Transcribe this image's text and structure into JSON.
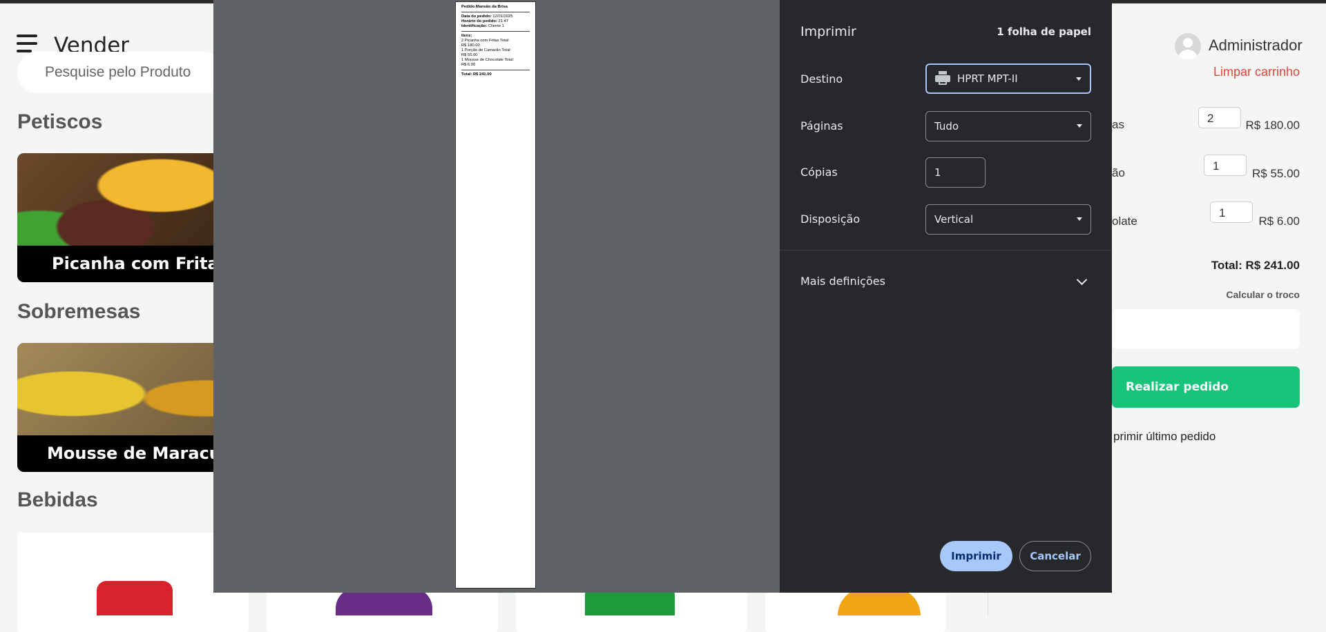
{
  "app": {
    "title": "Vender",
    "search_placeholder": "Pesquise pelo Produto"
  },
  "menu": {
    "sections": [
      {
        "title": "Petiscos",
        "items": [
          "Picanha com Fritas"
        ]
      },
      {
        "title": "Sobremesas",
        "items": [
          "Mousse de Maracujá"
        ]
      },
      {
        "title": "Bebidas",
        "items": []
      }
    ]
  },
  "cart": {
    "user": "Administrador",
    "clear_label": "Limpar carrinho",
    "items": [
      {
        "name_visible": "as",
        "qty": "2",
        "price": "R$ 180.00"
      },
      {
        "name_visible": "ão",
        "qty": "1",
        "price": "R$ 55.00"
      },
      {
        "name_visible": "olate",
        "qty": "1",
        "price": "R$ 6.00"
      }
    ],
    "total": "Total: R$ 241.00",
    "change_label": "Calcular o troco",
    "order_button": "Realizar pedido",
    "reprint_label": "primir último pedido"
  },
  "print_dialog": {
    "title": "Imprimir",
    "sheet_count": "1 folha de papel",
    "destination_label": "Destino",
    "destination_value": "HPRT MPT-II",
    "pages_label": "Páginas",
    "pages_value": "Tudo",
    "copies_label": "Cópias",
    "copies_value": "1",
    "layout_label": "Disposição",
    "layout_value": "Vertical",
    "more_settings": "Mais definições",
    "print_button": "Imprimir",
    "cancel_button": "Cancelar",
    "preview": {
      "heading": "Pedido Mansão da Brisa",
      "date_label": "Data do pedido:",
      "date": "12/01/2025",
      "time_label": "Horário do pedido:",
      "time": "21:47",
      "id_label": "Identificação:",
      "id": "Cliente 1",
      "items_label": "Itens:",
      "lines": [
        "2 Picanha com Fritas Total:",
        "R$ 180.00",
        "1 Porção de Camarão Total:",
        "R$ 55.00",
        "1 Mousse de Chocolate Total:",
        "R$ 6.00"
      ],
      "total": "Total: R$ 241.00"
    }
  },
  "colors": {
    "accent_green": "#17c47a",
    "clear_red": "#e0453a",
    "dialog_bg": "#27282c",
    "preview_bg": "#5f6267",
    "primary_button": "#a8c7fa"
  }
}
